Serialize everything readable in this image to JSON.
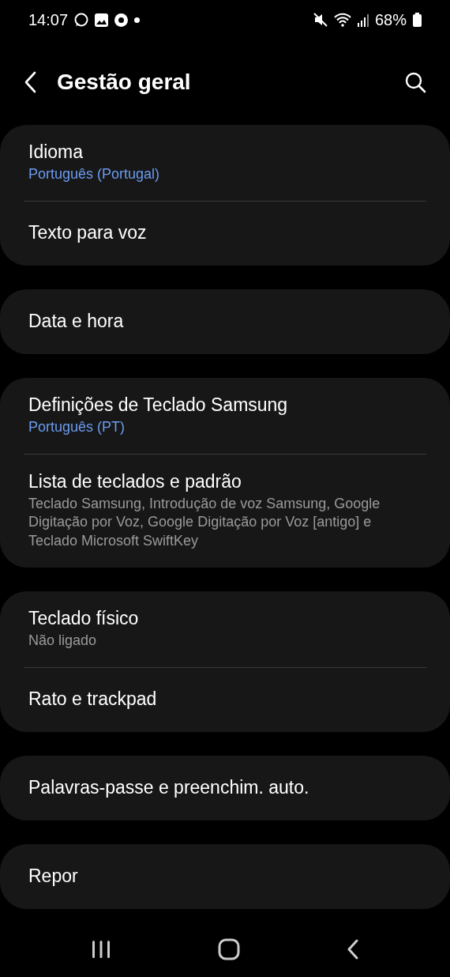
{
  "status_bar": {
    "time": "14:07",
    "battery": "68%"
  },
  "header": {
    "title": "Gestão geral"
  },
  "groups": [
    {
      "items": [
        {
          "title": "Idioma",
          "subtitle": "Português (Portugal)",
          "accent": true
        },
        {
          "title": "Texto para voz"
        }
      ]
    },
    {
      "items": [
        {
          "title": "Data e hora"
        }
      ]
    },
    {
      "items": [
        {
          "title": "Definições de Teclado Samsung",
          "subtitle": "Português (PT)",
          "accent": true
        },
        {
          "title": "Lista de teclados e padrão",
          "subtitle": "Teclado Samsung, Introdução de voz Samsung, Google Digitação por Voz, Google Digitação por Voz [antigo] e Teclado Microsoft SwiftKey",
          "accent": false
        }
      ]
    },
    {
      "items": [
        {
          "title": "Teclado físico",
          "subtitle": "Não ligado",
          "accent": false
        },
        {
          "title": "Rato e trackpad"
        }
      ]
    },
    {
      "items": [
        {
          "title": "Palavras-passe e preenchim. auto."
        }
      ]
    },
    {
      "items": [
        {
          "title": "Repor"
        }
      ]
    }
  ]
}
